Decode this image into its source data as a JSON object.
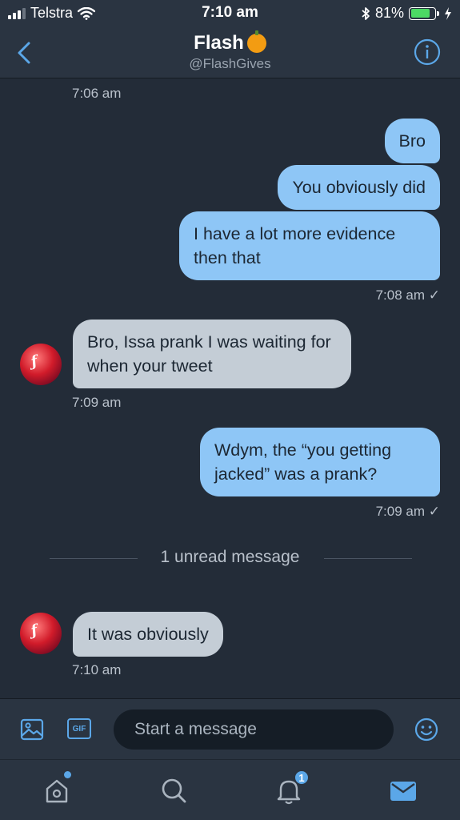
{
  "status_bar": {
    "carrier": "Telstra",
    "time": "7:10 am",
    "battery_percent": "81%",
    "battery_level": 0.81
  },
  "header": {
    "name": "Flash",
    "handle": "@FlashGives"
  },
  "messages": [
    {
      "timestamp": "7:06 am"
    },
    {
      "direction": "out",
      "text": "Bro"
    },
    {
      "direction": "out",
      "text": "You obviously did"
    },
    {
      "direction": "out",
      "text": "I have a lot more evidence then that"
    },
    {
      "timestamp": "7:08 am ✓"
    },
    {
      "direction": "in",
      "text": "Bro, Issa prank I was waiting for when your tweet"
    },
    {
      "timestamp": "7:09 am"
    },
    {
      "direction": "out",
      "text": "Wdym, the “you getting jacked” was a prank?"
    },
    {
      "timestamp": "7:09 am ✓"
    },
    {
      "divider": "1 unread message"
    },
    {
      "direction": "in",
      "text": "It was obviously"
    },
    {
      "timestamp": "7:10 am"
    }
  ],
  "avatar_mark": "ƒ",
  "composer": {
    "gif_label": "GIF",
    "placeholder": "Start a message"
  },
  "tabbar": {
    "notifications_count": "1"
  },
  "colors": {
    "background": "#232c38",
    "bar": "#2a3441",
    "outgoing_bubble": "#8ec6f6",
    "incoming_bubble": "#c4cdd6",
    "accent": "#5ba7e8"
  }
}
